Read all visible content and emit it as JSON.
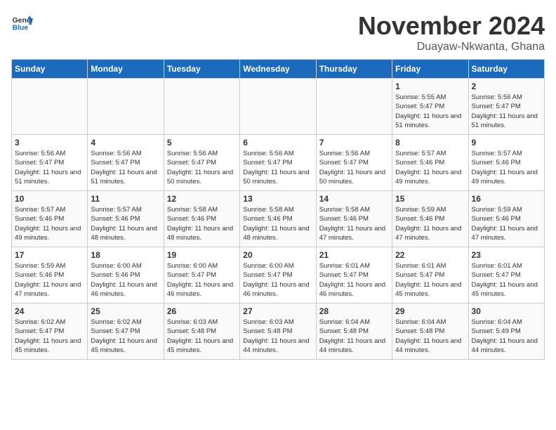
{
  "logo": {
    "text_general": "General",
    "text_blue": "Blue"
  },
  "title": "November 2024",
  "location": "Duayaw-Nkwanta, Ghana",
  "weekdays": [
    "Sunday",
    "Monday",
    "Tuesday",
    "Wednesday",
    "Thursday",
    "Friday",
    "Saturday"
  ],
  "weeks": [
    [
      {
        "day": "",
        "info": ""
      },
      {
        "day": "",
        "info": ""
      },
      {
        "day": "",
        "info": ""
      },
      {
        "day": "",
        "info": ""
      },
      {
        "day": "",
        "info": ""
      },
      {
        "day": "1",
        "info": "Sunrise: 5:55 AM\nSunset: 5:47 PM\nDaylight: 11 hours and 51 minutes."
      },
      {
        "day": "2",
        "info": "Sunrise: 5:56 AM\nSunset: 5:47 PM\nDaylight: 11 hours and 51 minutes."
      }
    ],
    [
      {
        "day": "3",
        "info": "Sunrise: 5:56 AM\nSunset: 5:47 PM\nDaylight: 11 hours and 51 minutes."
      },
      {
        "day": "4",
        "info": "Sunrise: 5:56 AM\nSunset: 5:47 PM\nDaylight: 11 hours and 51 minutes."
      },
      {
        "day": "5",
        "info": "Sunrise: 5:56 AM\nSunset: 5:47 PM\nDaylight: 11 hours and 50 minutes."
      },
      {
        "day": "6",
        "info": "Sunrise: 5:56 AM\nSunset: 5:47 PM\nDaylight: 11 hours and 50 minutes."
      },
      {
        "day": "7",
        "info": "Sunrise: 5:56 AM\nSunset: 5:47 PM\nDaylight: 11 hours and 50 minutes."
      },
      {
        "day": "8",
        "info": "Sunrise: 5:57 AM\nSunset: 5:46 PM\nDaylight: 11 hours and 49 minutes."
      },
      {
        "day": "9",
        "info": "Sunrise: 5:57 AM\nSunset: 5:46 PM\nDaylight: 11 hours and 49 minutes."
      }
    ],
    [
      {
        "day": "10",
        "info": "Sunrise: 5:57 AM\nSunset: 5:46 PM\nDaylight: 11 hours and 49 minutes."
      },
      {
        "day": "11",
        "info": "Sunrise: 5:57 AM\nSunset: 5:46 PM\nDaylight: 11 hours and 48 minutes."
      },
      {
        "day": "12",
        "info": "Sunrise: 5:58 AM\nSunset: 5:46 PM\nDaylight: 11 hours and 48 minutes."
      },
      {
        "day": "13",
        "info": "Sunrise: 5:58 AM\nSunset: 5:46 PM\nDaylight: 11 hours and 48 minutes."
      },
      {
        "day": "14",
        "info": "Sunrise: 5:58 AM\nSunset: 5:46 PM\nDaylight: 11 hours and 47 minutes."
      },
      {
        "day": "15",
        "info": "Sunrise: 5:59 AM\nSunset: 5:46 PM\nDaylight: 11 hours and 47 minutes."
      },
      {
        "day": "16",
        "info": "Sunrise: 5:59 AM\nSunset: 5:46 PM\nDaylight: 11 hours and 47 minutes."
      }
    ],
    [
      {
        "day": "17",
        "info": "Sunrise: 5:59 AM\nSunset: 5:46 PM\nDaylight: 11 hours and 47 minutes."
      },
      {
        "day": "18",
        "info": "Sunrise: 6:00 AM\nSunset: 5:46 PM\nDaylight: 11 hours and 46 minutes."
      },
      {
        "day": "19",
        "info": "Sunrise: 6:00 AM\nSunset: 5:47 PM\nDaylight: 11 hours and 46 minutes."
      },
      {
        "day": "20",
        "info": "Sunrise: 6:00 AM\nSunset: 5:47 PM\nDaylight: 11 hours and 46 minutes."
      },
      {
        "day": "21",
        "info": "Sunrise: 6:01 AM\nSunset: 5:47 PM\nDaylight: 11 hours and 46 minutes."
      },
      {
        "day": "22",
        "info": "Sunrise: 6:01 AM\nSunset: 5:47 PM\nDaylight: 11 hours and 45 minutes."
      },
      {
        "day": "23",
        "info": "Sunrise: 6:01 AM\nSunset: 5:47 PM\nDaylight: 11 hours and 45 minutes."
      }
    ],
    [
      {
        "day": "24",
        "info": "Sunrise: 6:02 AM\nSunset: 5:47 PM\nDaylight: 11 hours and 45 minutes."
      },
      {
        "day": "25",
        "info": "Sunrise: 6:02 AM\nSunset: 5:47 PM\nDaylight: 11 hours and 45 minutes."
      },
      {
        "day": "26",
        "info": "Sunrise: 6:03 AM\nSunset: 5:48 PM\nDaylight: 11 hours and 45 minutes."
      },
      {
        "day": "27",
        "info": "Sunrise: 6:03 AM\nSunset: 5:48 PM\nDaylight: 11 hours and 44 minutes."
      },
      {
        "day": "28",
        "info": "Sunrise: 6:04 AM\nSunset: 5:48 PM\nDaylight: 11 hours and 44 minutes."
      },
      {
        "day": "29",
        "info": "Sunrise: 6:04 AM\nSunset: 5:48 PM\nDaylight: 11 hours and 44 minutes."
      },
      {
        "day": "30",
        "info": "Sunrise: 6:04 AM\nSunset: 5:49 PM\nDaylight: 11 hours and 44 minutes."
      }
    ]
  ]
}
